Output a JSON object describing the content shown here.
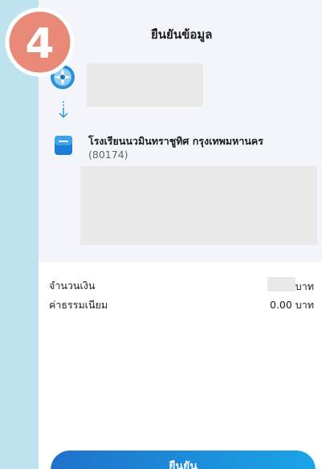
{
  "badge": {
    "number": "4"
  },
  "header": {
    "title": "ยืนยันข้อมูล"
  },
  "recipient": {
    "name": "โรงเรียนนวมินทราชูทิศ กรุงเทพมหานคร",
    "code": "(80174)"
  },
  "summary": {
    "amount_label": "จำนวนเงิน",
    "amount_unit": "บาท",
    "fee_label": "ค่าธรรมเนียม",
    "fee_value": "0.00 บาท"
  },
  "actions": {
    "confirm_label": "ยืนยัน"
  },
  "colors": {
    "background": "#bfe3ef",
    "badge": "#e98a78",
    "button_start": "#1e72c9",
    "button_end": "#1aa4e8"
  },
  "icons": [
    "bank-logo-icon",
    "down-arrow-icon",
    "school-document-icon"
  ]
}
